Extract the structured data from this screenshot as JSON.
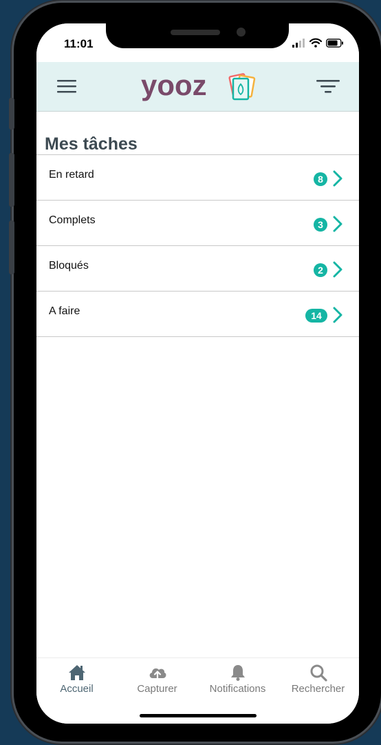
{
  "status_bar": {
    "time": "11:01"
  },
  "app": {
    "logo_text": "yooz"
  },
  "section": {
    "title": "Mes tâches"
  },
  "tasks": [
    {
      "label": "En retard",
      "count": "8"
    },
    {
      "label": "Complets",
      "count": "3"
    },
    {
      "label": "Bloqués",
      "count": "2"
    },
    {
      "label": "A faire",
      "count": "14"
    }
  ],
  "tabs": [
    {
      "label": "Accueil",
      "icon": "home-icon",
      "active": true
    },
    {
      "label": "Capturer",
      "icon": "cloud-upload-icon",
      "active": false
    },
    {
      "label": "Notifications",
      "icon": "bell-icon",
      "active": false
    },
    {
      "label": "Rechercher",
      "icon": "search-icon",
      "active": false
    }
  ],
  "colors": {
    "accent": "#15b5a4",
    "header_bg": "#e2f2f2",
    "logo": "#7a4a6a",
    "active_tab": "#4e6673",
    "inactive_tab": "#7a7a7a"
  }
}
